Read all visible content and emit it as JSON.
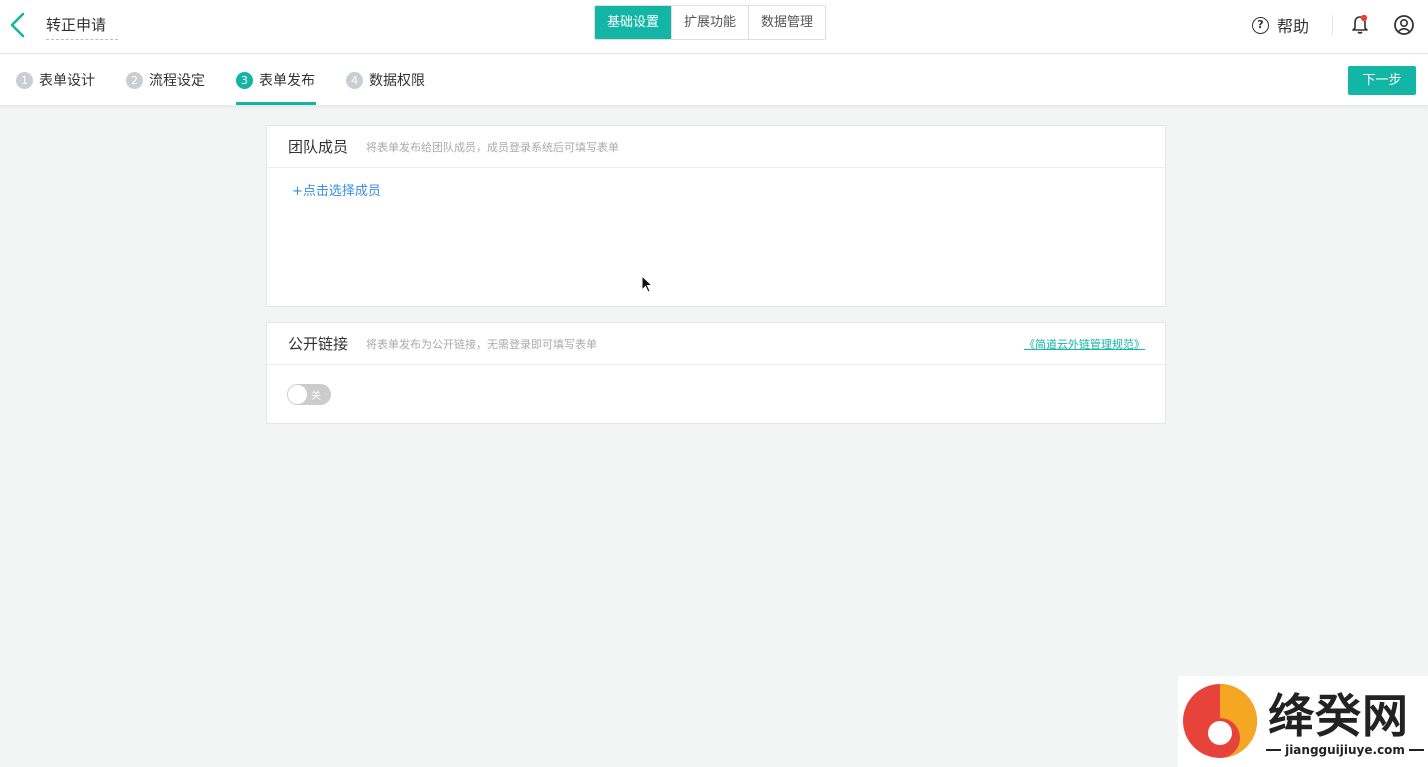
{
  "header": {
    "title": "转正申请",
    "tabs": [
      {
        "label": "基础设置",
        "active": true
      },
      {
        "label": "扩展功能",
        "active": false
      },
      {
        "label": "数据管理",
        "active": false
      }
    ],
    "help_label": "帮助"
  },
  "steps": {
    "items": [
      {
        "num": "1",
        "label": "表单设计"
      },
      {
        "num": "2",
        "label": "流程设定"
      },
      {
        "num": "3",
        "label": "表单发布"
      },
      {
        "num": "4",
        "label": "数据权限"
      }
    ],
    "active_index": 2,
    "next_label": "下一步"
  },
  "team_card": {
    "title": "团队成员",
    "desc": "将表单发布给团队成员，成员登录系统后可填写表单",
    "add_label": "+点击选择成员"
  },
  "public_card": {
    "title": "公开链接",
    "desc": "将表单发布为公开链接，无需登录即可填写表单",
    "rule_link": "《简道云外链管理规范》",
    "toggle_label": "关",
    "toggle_on": false
  },
  "watermark": {
    "name": "绛癸网",
    "url": "jiangguijiuye.com"
  },
  "colors": {
    "accent": "#13b5a5",
    "link": "#3a8ee6",
    "background": "#f3f4f4"
  }
}
